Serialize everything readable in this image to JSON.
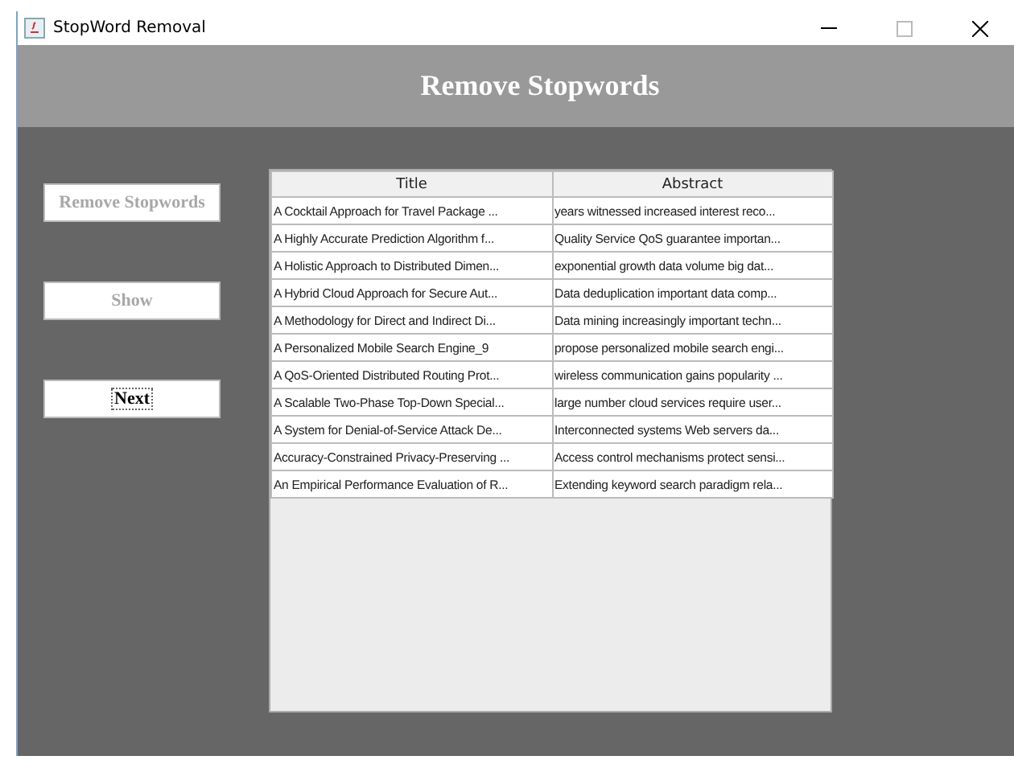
{
  "window": {
    "title": "StopWord Removal"
  },
  "header": {
    "title": "Remove Stopwords"
  },
  "buttons": [
    {
      "label": "Remove Stopwords",
      "disabled": true,
      "focused": false
    },
    {
      "label": "Show",
      "disabled": true,
      "focused": false
    },
    {
      "label": "Next",
      "disabled": false,
      "focused": true
    }
  ],
  "table": {
    "columns": [
      "Title",
      "Abstract"
    ],
    "rows": [
      [
        "A Cocktail Approach for Travel Package ...",
        "years witnessed increased interest reco..."
      ],
      [
        "A Highly Accurate Prediction Algorithm f...",
        "Quality Service QoS guarantee importan..."
      ],
      [
        "A Holistic Approach to Distributed Dimen...",
        "exponential growth data volume big dat..."
      ],
      [
        "A Hybrid Cloud Approach for Secure Aut...",
        "Data deduplication important data comp..."
      ],
      [
        "A Methodology for Direct and Indirect Di...",
        "Data mining increasingly important techn..."
      ],
      [
        "A Personalized Mobile Search Engine_9",
        "propose personalized mobile search engi..."
      ],
      [
        "A QoS-Oriented Distributed Routing Prot...",
        "wireless communication gains popularity ..."
      ],
      [
        "A Scalable Two-Phase Top-Down Special...",
        "large number cloud services require user..."
      ],
      [
        "A System for Denial-of-Service Attack De...",
        "Interconnected systems Web servers da..."
      ],
      [
        "Accuracy-Constrained Privacy-Preserving ...",
        "Access control mechanisms protect sensi..."
      ],
      [
        "An Empirical Performance Evaluation of R...",
        "Extending keyword search paradigm rela..."
      ]
    ]
  }
}
